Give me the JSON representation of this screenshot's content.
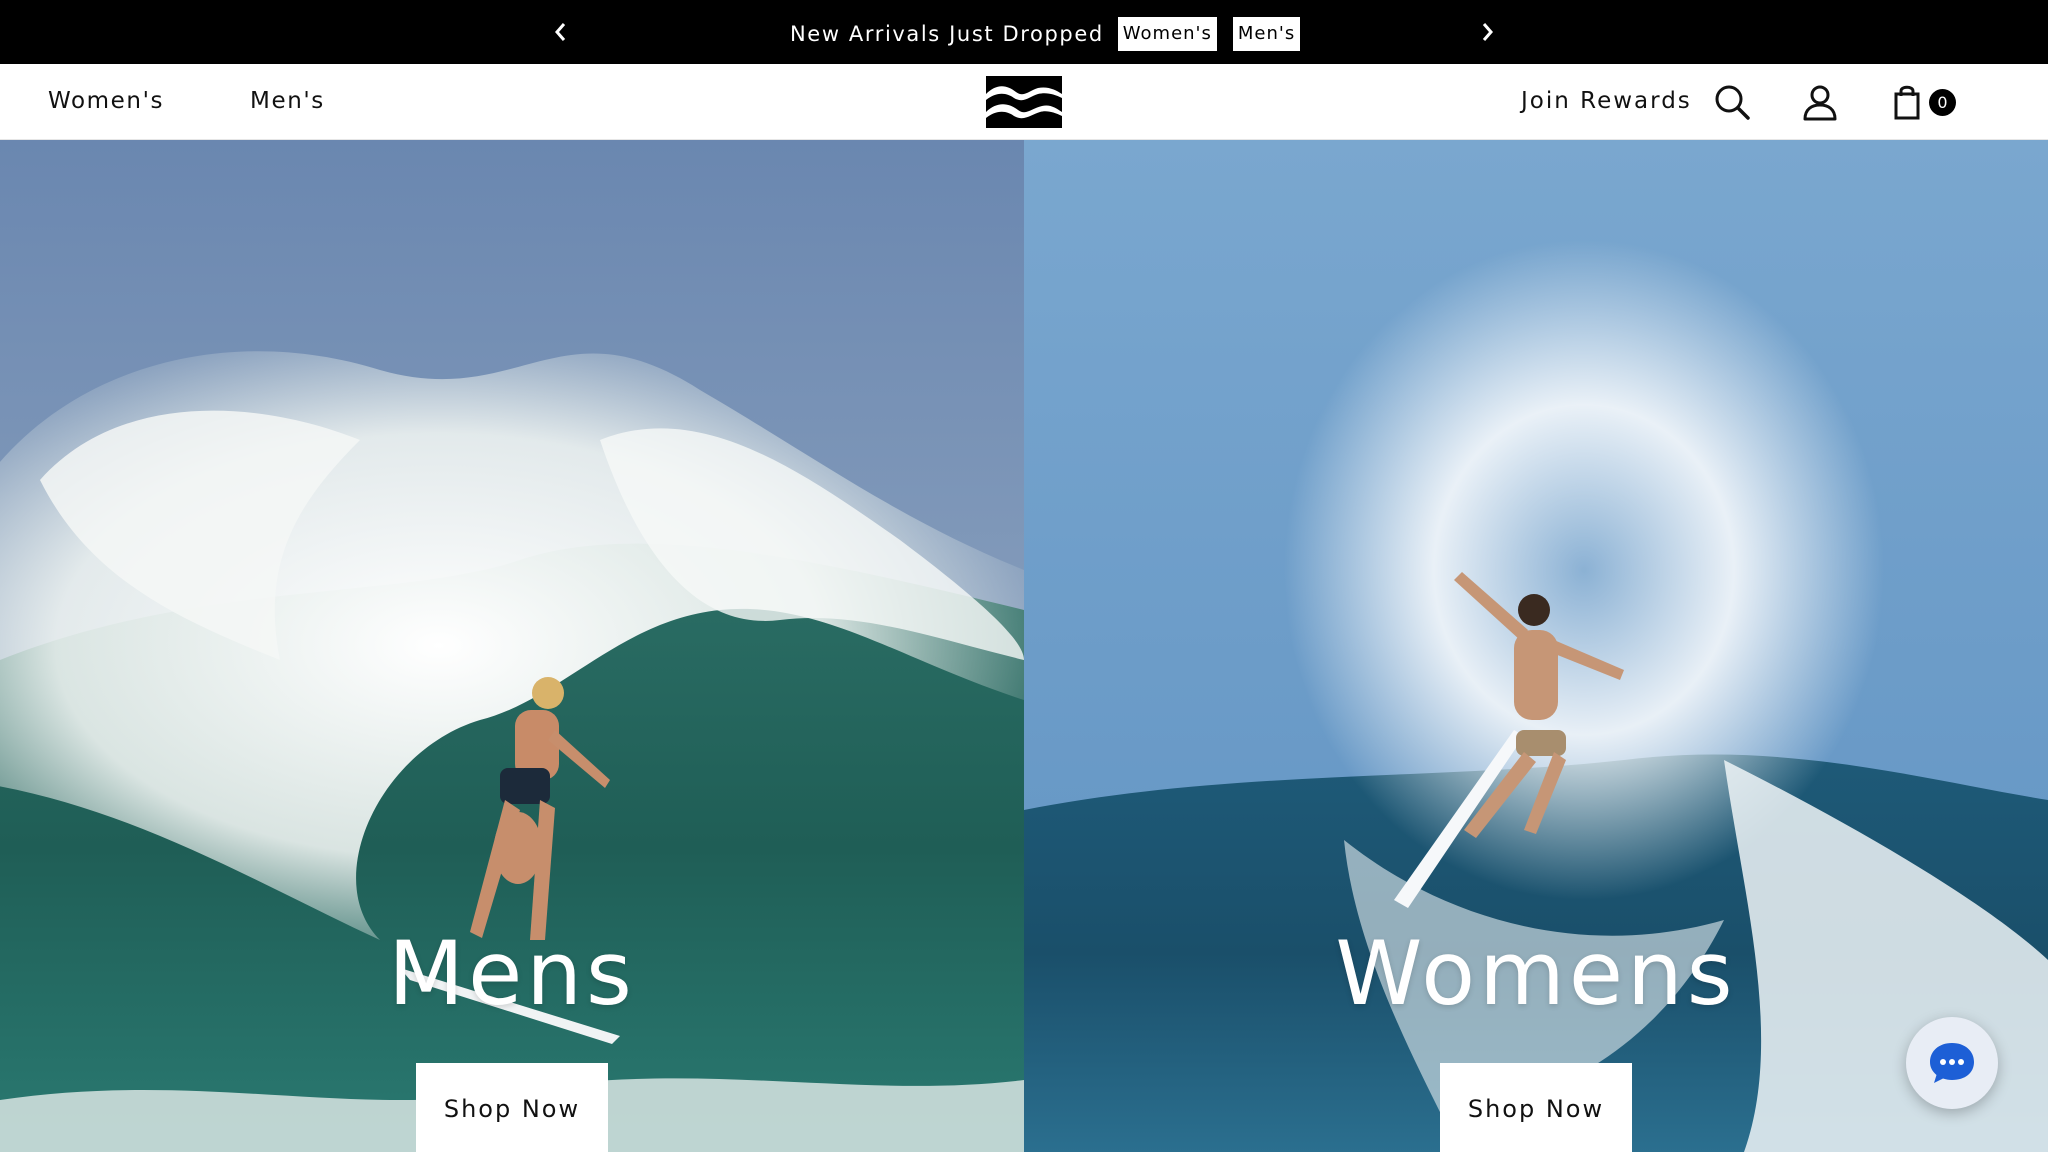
{
  "announcement": {
    "message": "New Arrivals Just Dropped",
    "links": [
      "Women's",
      "Men's"
    ],
    "prev_icon": "chevron-left-icon",
    "next_icon": "chevron-right-icon"
  },
  "header": {
    "nav": [
      "Women's",
      "Men's"
    ],
    "logo_icon": "billabong-logo",
    "rewards_label": "Join Rewards",
    "cart_count": "0"
  },
  "hero": {
    "left": {
      "title": "Mens",
      "button": "Shop Now"
    },
    "right": {
      "title": "Womens",
      "button": "Shop Now"
    }
  },
  "chat": {
    "icon": "chat-bubble-icon",
    "accent": "#1d5fd6"
  }
}
